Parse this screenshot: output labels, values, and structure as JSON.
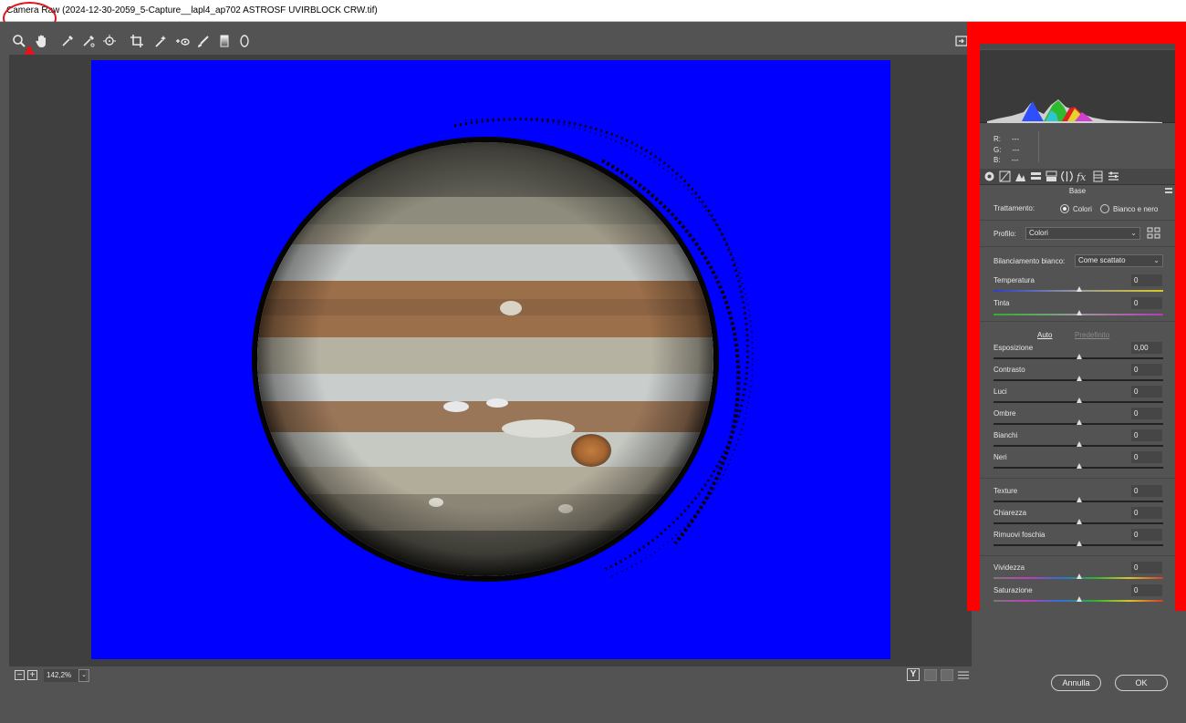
{
  "window": {
    "title": "Camera Raw (2024-12-30-2059_5-Capture__lapl4_ap702 ASTROSF UVIRBLOCK CRW.tif)"
  },
  "toolbar": {
    "tools": [
      "zoom-icon",
      "hand-icon",
      "white-balance-icon",
      "color-sampler-icon",
      "targeted-adjustment-icon",
      "crop-icon",
      "spot-removal-icon",
      "red-eye-icon",
      "adjustment-brush-icon",
      "graduated-filter-icon",
      "radial-filter-icon"
    ]
  },
  "status": {
    "zoom": "142,2%"
  },
  "view": {
    "mode_label": "Y"
  },
  "panel": {
    "rgb": {
      "r_label": "R:",
      "r_value": "---",
      "g_label": "G:",
      "g_value": "---",
      "b_label": "B:",
      "b_value": "---"
    },
    "section_title": "Base",
    "treatment": {
      "label": "Trattamento:",
      "option_color": "Colori",
      "option_bw": "Bianco e nero",
      "selected": "Colori"
    },
    "profile": {
      "label": "Profilo:",
      "value": "Colori"
    },
    "white_balance": {
      "label": "Bilanciamento bianco:",
      "value": "Come scattato"
    },
    "temperature": {
      "label": "Temperatura",
      "value": "0"
    },
    "tint": {
      "label": "Tinta",
      "value": "0"
    },
    "auto_label": "Auto",
    "default_label": "Predefinito",
    "exposure": {
      "label": "Esposizione",
      "value": "0,00"
    },
    "contrast": {
      "label": "Contrasto",
      "value": "0"
    },
    "highlights": {
      "label": "Luci",
      "value": "0"
    },
    "shadows": {
      "label": "Ombre",
      "value": "0"
    },
    "whites": {
      "label": "Bianchi",
      "value": "0"
    },
    "blacks": {
      "label": "Neri",
      "value": "0"
    },
    "texture": {
      "label": "Texture",
      "value": "0"
    },
    "clarity": {
      "label": "Chiarezza",
      "value": "0"
    },
    "dehaze": {
      "label": "Rimuovi foschia",
      "value": "0"
    },
    "vibrance": {
      "label": "Vividezza",
      "value": "0"
    },
    "saturation": {
      "label": "Saturazione",
      "value": "0"
    }
  },
  "buttons": {
    "cancel": "Annulla",
    "ok": "OK"
  },
  "colors": {
    "highlight_red": "#ff0000",
    "preview_background": "#0000ff"
  }
}
